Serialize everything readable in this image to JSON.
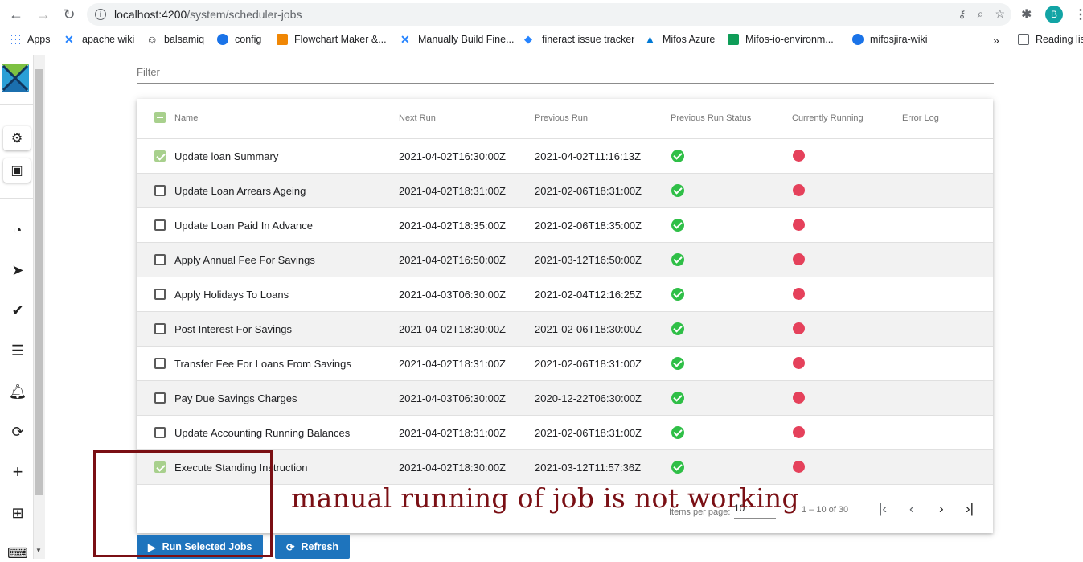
{
  "browser": {
    "url_host": "localhost:4200",
    "url_path": "/system/scheduler-jobs",
    "profile_initial": "B",
    "bookmarks": [
      {
        "label": "Apps",
        "icon": "apps-grid-icon",
        "color": "#4285f4"
      },
      {
        "label": "apache wiki",
        "icon": "confluence-icon",
        "color": "#2684ff"
      },
      {
        "label": "balsamiq",
        "icon": "smiley-icon",
        "color": "#222222"
      },
      {
        "label": "config",
        "icon": "globe-icon",
        "color": "#1a73e8"
      },
      {
        "label": "Flowchart Maker &...",
        "icon": "drawio-icon",
        "color": "#f08705"
      },
      {
        "label": "Manually Build Fine...",
        "icon": "confluence-icon",
        "color": "#2684ff"
      },
      {
        "label": "fineract issue tracker",
        "icon": "jira-icon",
        "color": "#2684ff"
      },
      {
        "label": "Mifos Azure",
        "icon": "azure-icon",
        "color": "#0078d4"
      },
      {
        "label": "Mifos-io-environm...",
        "icon": "sheets-icon",
        "color": "#0f9d58"
      },
      {
        "label": "mifosjira-wiki",
        "icon": "globe-icon",
        "color": "#1a73e8"
      }
    ],
    "more_bookmarks": "»",
    "reading_list": "Reading lis"
  },
  "filter": {
    "placeholder": "Filter"
  },
  "table": {
    "headers": {
      "name": "Name",
      "next_run": "Next Run",
      "previous_run": "Previous Run",
      "previous_run_status": "Previous Run Status",
      "currently_running": "Currently Running",
      "error_log": "Error Log"
    },
    "rows": [
      {
        "checked": true,
        "name": "Update loan Summary",
        "next_run": "2021-04-02T16:30:00Z",
        "previous_run": "2021-04-02T11:16:13Z"
      },
      {
        "checked": false,
        "name": "Update Loan Arrears Ageing",
        "next_run": "2021-04-02T18:31:00Z",
        "previous_run": "2021-02-06T18:31:00Z"
      },
      {
        "checked": false,
        "name": "Update Loan Paid In Advance",
        "next_run": "2021-04-02T18:35:00Z",
        "previous_run": "2021-02-06T18:35:00Z"
      },
      {
        "checked": false,
        "name": "Apply Annual Fee For Savings",
        "next_run": "2021-04-02T16:50:00Z",
        "previous_run": "2021-03-12T16:50:00Z"
      },
      {
        "checked": false,
        "name": "Apply Holidays To Loans",
        "next_run": "2021-04-03T06:30:00Z",
        "previous_run": "2021-02-04T12:16:25Z"
      },
      {
        "checked": false,
        "name": "Post Interest For Savings",
        "next_run": "2021-04-02T18:30:00Z",
        "previous_run": "2021-02-06T18:30:00Z"
      },
      {
        "checked": false,
        "name": "Transfer Fee For Loans From Savings",
        "next_run": "2021-04-02T18:31:00Z",
        "previous_run": "2021-02-06T18:31:00Z"
      },
      {
        "checked": false,
        "name": "Pay Due Savings Charges",
        "next_run": "2021-04-03T06:30:00Z",
        "previous_run": "2020-12-22T06:30:00Z"
      },
      {
        "checked": false,
        "name": "Update Accounting Running Balances",
        "next_run": "2021-04-02T18:31:00Z",
        "previous_run": "2021-02-06T18:31:00Z"
      },
      {
        "checked": true,
        "name": "Execute Standing Instruction",
        "next_run": "2021-04-02T18:30:00Z",
        "previous_run": "2021-03-12T11:57:36Z"
      }
    ]
  },
  "paginator": {
    "items_per_page_label": "Items per page:",
    "page_size": "10",
    "range": "1 – 10 of 30"
  },
  "actions": {
    "run_selected": "Run Selected Jobs",
    "refresh": "Refresh"
  },
  "annotation": {
    "text": "manual running of job is not working",
    "color": "#7a0f14"
  },
  "colors": {
    "primary_button": "#1e74bd",
    "status_ok": "#2fbf47",
    "status_not_running": "#e5415b",
    "checkbox_checked": "#a8d08d"
  }
}
